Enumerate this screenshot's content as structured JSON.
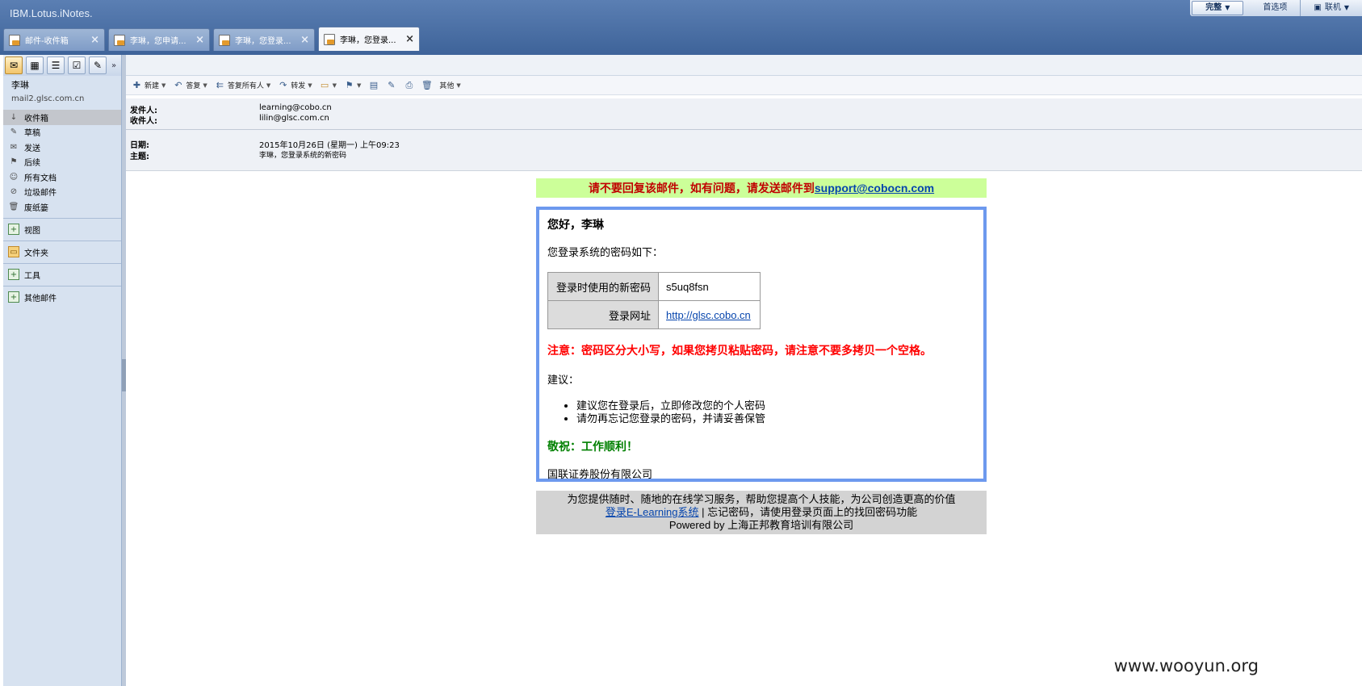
{
  "app": {
    "brand": "IBM.Lotus.iNotes."
  },
  "topbar": {
    "mode": "完整",
    "preferences": "首选项",
    "online": "联机"
  },
  "tabs": [
    {
      "label": "邮件-收件箱"
    },
    {
      "label": "李琳，您申请..."
    },
    {
      "label": "李琳，您登录..."
    },
    {
      "label": "李琳，您登录..."
    }
  ],
  "user": {
    "name": "李琳",
    "server": "mail2.glsc.com.cn"
  },
  "nav": [
    {
      "label": "收件箱",
      "icon": "inbox-icon"
    },
    {
      "label": "草稿",
      "icon": "draft-icon"
    },
    {
      "label": "发送",
      "icon": "sent-icon"
    },
    {
      "label": "后续",
      "icon": "flag-icon"
    },
    {
      "label": "所有文档",
      "icon": "all-docs-icon"
    },
    {
      "label": "垃圾邮件",
      "icon": "junk-icon"
    },
    {
      "label": "废纸篓",
      "icon": "trash-icon"
    }
  ],
  "sections": {
    "views": "视图",
    "folders": "文件夹",
    "tools": "工具",
    "other_mail": "其他邮件"
  },
  "actions": {
    "new": "新建",
    "reply": "答复",
    "reply_all": "答复所有人",
    "forward": "转发",
    "more": "其他"
  },
  "header": {
    "from_label": "发件人:",
    "from": "learning@cobo.cn",
    "to_label": "收件人:",
    "to": "lilin@glsc.com.cn",
    "date_label": "日期:",
    "date": "2015年10月26日 (星期一) 上午09:23",
    "subject_label": "主题:",
    "subject": "李琳，您登录系统的新密码"
  },
  "mail": {
    "notice_text": "请不要回复该邮件，如有问题，请发送邮件到",
    "notice_email": "support@cobocn.com",
    "greeting": "您好，李琳",
    "intro": "您登录系统的密码如下：",
    "pw_label": "登录时使用的新密码",
    "pw_value": "s5uq8fsn",
    "url_label": "登录网址",
    "url_value": "http://glsc.cobo.cn",
    "warning": "注意：密码区分大小写，如果您拷贝粘贴密码，请注意不要多拷贝一个空格。",
    "suggest_title": "建议：",
    "tips": [
      "建议您在登录后，立即修改您的个人密码",
      "请勿再忘记您登录的密码，并请妥善保管"
    ],
    "regards": "敬祝：工作顺利！",
    "company": "国联证券股份有限公司"
  },
  "footer": {
    "line1": "为您提供随时、随地的在线学习服务，帮助您提高个人技能，为公司创造更高的价值",
    "link": "登录E-Learning系统",
    "line2_rest": " | 忘记密码，请使用登录页面上的找回密码功能",
    "line3": "Powered by 上海正邦教育培训有限公司"
  },
  "watermark": "www.wooyun.org"
}
